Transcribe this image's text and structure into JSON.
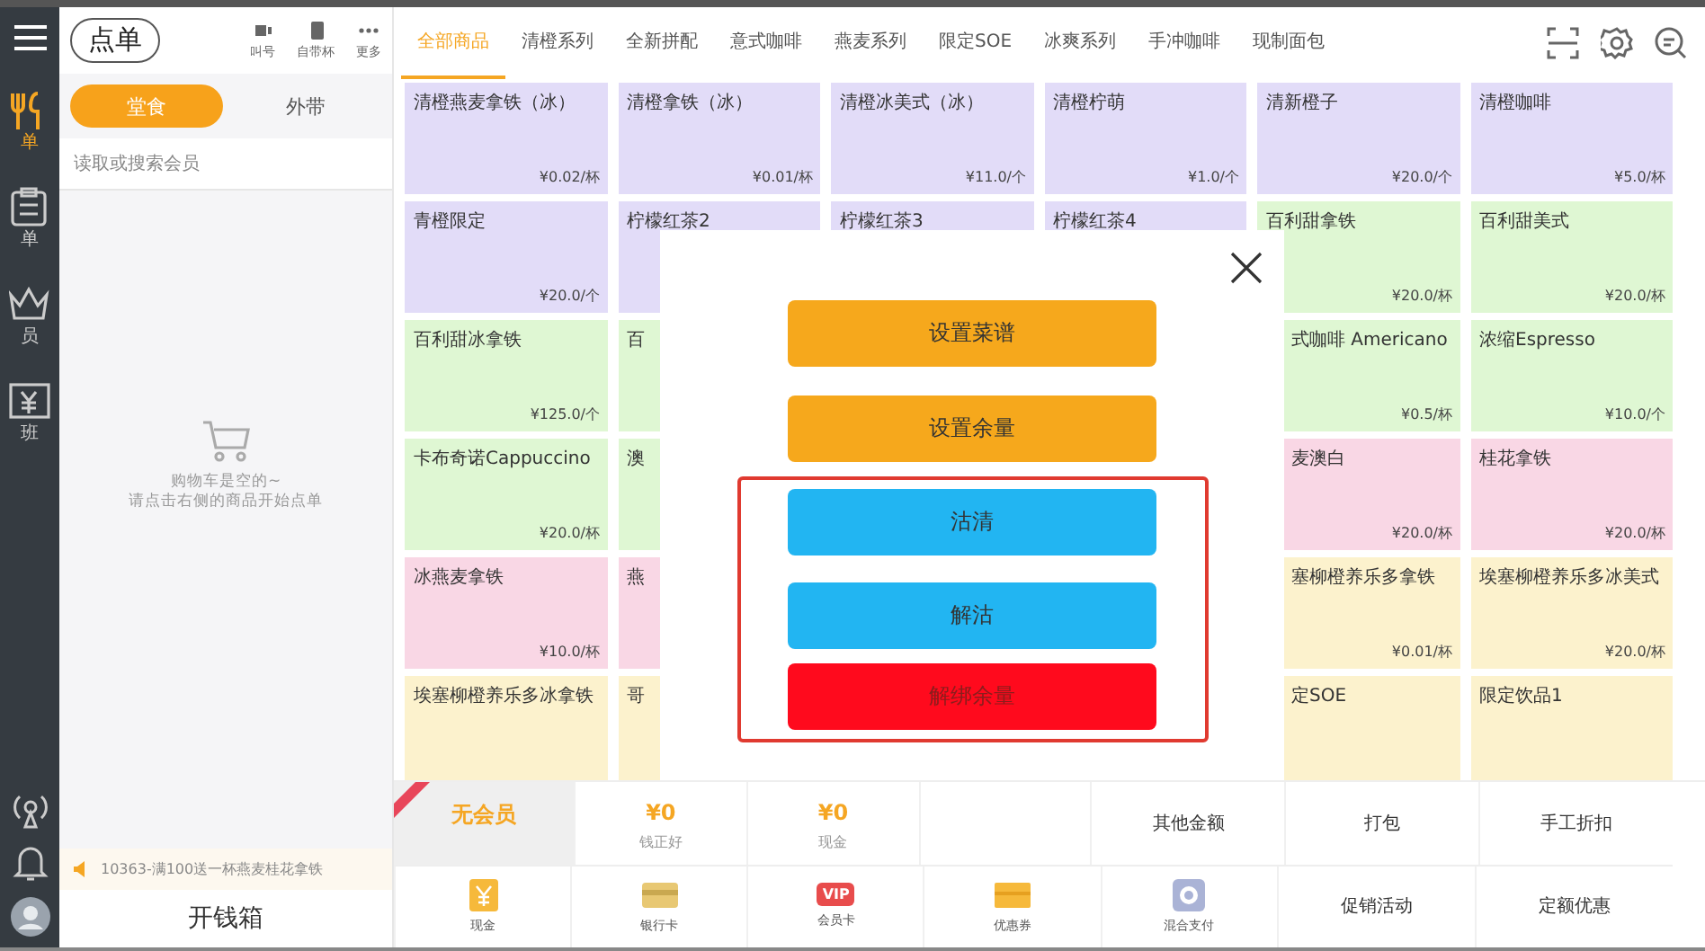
{
  "rail": {
    "items": [
      {
        "label": "单",
        "selected": true
      },
      {
        "label": "单",
        "selected": false
      },
      {
        "label": "员",
        "selected": false
      },
      {
        "label": "班",
        "selected": false
      }
    ]
  },
  "order_panel": {
    "title": "点单",
    "tools": [
      {
        "label": "叫号"
      },
      {
        "label": "自带杯"
      },
      {
        "label": "更多"
      }
    ],
    "dine_tabs": [
      {
        "label": "堂食",
        "selected": true
      },
      {
        "label": "外带",
        "selected": false
      }
    ],
    "member_search": {
      "placeholder": "读取或搜索会员"
    },
    "empty_cart": [
      "购物车是空的~",
      "请点击右侧的商品开始点单"
    ],
    "notice": "10363-满100送一杯燕麦桂花拿铁",
    "cash_drawer": "开钱箱"
  },
  "categories": [
    {
      "label": "全部商品",
      "selected": true
    },
    {
      "label": "清橙系列",
      "selected": false
    },
    {
      "label": "全新拼配",
      "selected": false
    },
    {
      "label": "意式咖啡",
      "selected": false
    },
    {
      "label": "燕麦系列",
      "selected": false
    },
    {
      "label": "限定SOE",
      "selected": false
    },
    {
      "label": "冰爽系列",
      "selected": false
    },
    {
      "label": "手冲咖啡",
      "selected": false
    },
    {
      "label": "现制面包",
      "selected": false
    }
  ],
  "products": [
    {
      "kind": "full",
      "name": "清橙燕麦拿铁（冰）",
      "price": "¥0.02/杯",
      "color": "#e2dcf8"
    },
    {
      "kind": "full",
      "name": "清橙拿铁（冰）",
      "price": "¥0.01/杯",
      "color": "#e2dcf8"
    },
    {
      "kind": "full",
      "name": "清橙冰美式（冰）",
      "price": "¥11.0/个",
      "color": "#e2dcf8"
    },
    {
      "kind": "full",
      "name": "清橙柠萌",
      "price": "¥1.0/个",
      "color": "#e2dcf8"
    },
    {
      "kind": "full",
      "name": "清新橙子",
      "price": "¥20.0/个",
      "color": "#e2dcf8"
    },
    {
      "kind": "full",
      "name": "清橙咖啡",
      "price": "¥5.0/杯",
      "color": "#e2dcf8"
    },
    {
      "kind": "full",
      "name": "青橙限定",
      "price": "¥20.0/个",
      "color": "#e2dcf8"
    },
    {
      "kind": "full",
      "name": "柠檬红茶2",
      "color": "#e2dcf8"
    },
    {
      "kind": "full",
      "name": "柠檬红茶3",
      "color": "#e2dcf8"
    },
    {
      "kind": "full",
      "name": "柠檬红茶4",
      "color": "#e2dcf8"
    },
    {
      "kind": "full",
      "name": "百利甜拿铁",
      "price": "¥20.0/杯",
      "color": "#dff7d3"
    },
    {
      "kind": "full",
      "name": "百利甜美式",
      "price": "¥20.0/杯",
      "color": "#dff7d3"
    },
    {
      "kind": "full",
      "name": "百利甜冰拿铁",
      "price": "¥125.0/个",
      "color": "#dff7d3"
    },
    {
      "kind": "full",
      "name": "百",
      "color": "#dff7d3"
    },
    {
      "kind": "covered"
    },
    {
      "kind": "covered"
    },
    {
      "kind": "partial",
      "name": "式咖啡 Americano",
      "price": "¥0.5/杯",
      "color": "#dff7d3"
    },
    {
      "kind": "full",
      "name": "浓缩Espresso",
      "price": "¥10.0/个",
      "color": "#dff7d3"
    },
    {
      "kind": "full",
      "name": "卡布奇诺Cappuccino",
      "price": "¥20.0/杯",
      "color": "#dff7d3"
    },
    {
      "kind": "full",
      "name": "澳",
      "color": "#dff7d3"
    },
    {
      "kind": "covered"
    },
    {
      "kind": "covered"
    },
    {
      "kind": "partial",
      "name": "麦澳白",
      "price": "¥20.0/杯",
      "color": "#f9d7e5"
    },
    {
      "kind": "full",
      "name": "桂花拿铁",
      "price": "¥20.0/杯",
      "color": "#f9d7e5"
    },
    {
      "kind": "full",
      "name": "冰燕麦拿铁",
      "price": "¥10.0/杯",
      "color": "#f9d7e5"
    },
    {
      "kind": "full",
      "name": "燕",
      "color": "#f9d7e5"
    },
    {
      "kind": "covered"
    },
    {
      "kind": "covered"
    },
    {
      "kind": "partial",
      "name": "塞柳橙养乐多拿铁",
      "price": "¥0.01/杯",
      "color": "#fcf2cd"
    },
    {
      "kind": "full",
      "name": "埃塞柳橙养乐多冰美式",
      "price": "¥20.0/杯",
      "color": "#fcf2cd"
    },
    {
      "kind": "full",
      "name": "埃塞柳橙养乐多冰拿铁",
      "color": "#fcf2cd"
    },
    {
      "kind": "full",
      "name": "哥",
      "color": "#fcf2cd"
    },
    {
      "kind": "covered"
    },
    {
      "kind": "covered"
    },
    {
      "kind": "partial",
      "name": "定SOE",
      "color": "#fcf2cd"
    },
    {
      "kind": "full",
      "name": "限定饮品1",
      "color": "#fcf2cd"
    }
  ],
  "dialog": {
    "buttons": [
      {
        "label": "设置菜谱",
        "kind": "orange"
      },
      {
        "label": "设置余量",
        "kind": "orange"
      }
    ],
    "highlighted_buttons": [
      {
        "label": "沽清",
        "kind": "blue"
      },
      {
        "label": "解沽",
        "kind": "blue"
      },
      {
        "label": "解绑余量",
        "kind": "red"
      }
    ]
  },
  "checkout": {
    "member": "无会员",
    "row1": [
      {
        "kind": "amount",
        "value": "¥0",
        "label": "钱正好"
      },
      {
        "kind": "amount",
        "value": "¥0",
        "label": "现金"
      },
      {
        "kind": "empty"
      },
      {
        "kind": "text",
        "label": "其他金额"
      },
      {
        "kind": "text",
        "label": "打包"
      },
      {
        "kind": "text",
        "label": "手工折扣"
      }
    ],
    "row2": [
      {
        "kind": "pay",
        "label": "现金"
      },
      {
        "kind": "pay",
        "label": "银行卡"
      },
      {
        "kind": "badge",
        "badge": "VIP",
        "label": "会员卡"
      },
      {
        "kind": "pay",
        "label": "优惠券"
      },
      {
        "kind": "pay",
        "label": "混合支付"
      },
      {
        "kind": "text",
        "label": "促销活动"
      },
      {
        "kind": "text",
        "label": "定额优惠"
      }
    ]
  }
}
